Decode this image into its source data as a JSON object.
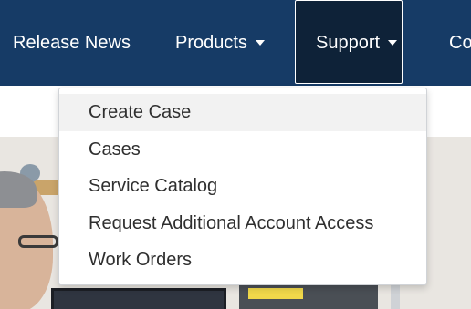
{
  "nav": {
    "items": [
      {
        "label": "Release News"
      },
      {
        "label": "Products"
      },
      {
        "label": "Support"
      },
      {
        "label": "Co"
      }
    ]
  },
  "support_menu": {
    "items": [
      {
        "label": "Create Case"
      },
      {
        "label": "Cases"
      },
      {
        "label": "Service Catalog"
      },
      {
        "label": "Request Additional Account Access"
      },
      {
        "label": "Work Orders"
      }
    ],
    "highlighted_index": 0
  },
  "colors": {
    "navbar": "#163b66",
    "active_nav": "#0e2238",
    "menu_hover": "#f2f2f2"
  }
}
